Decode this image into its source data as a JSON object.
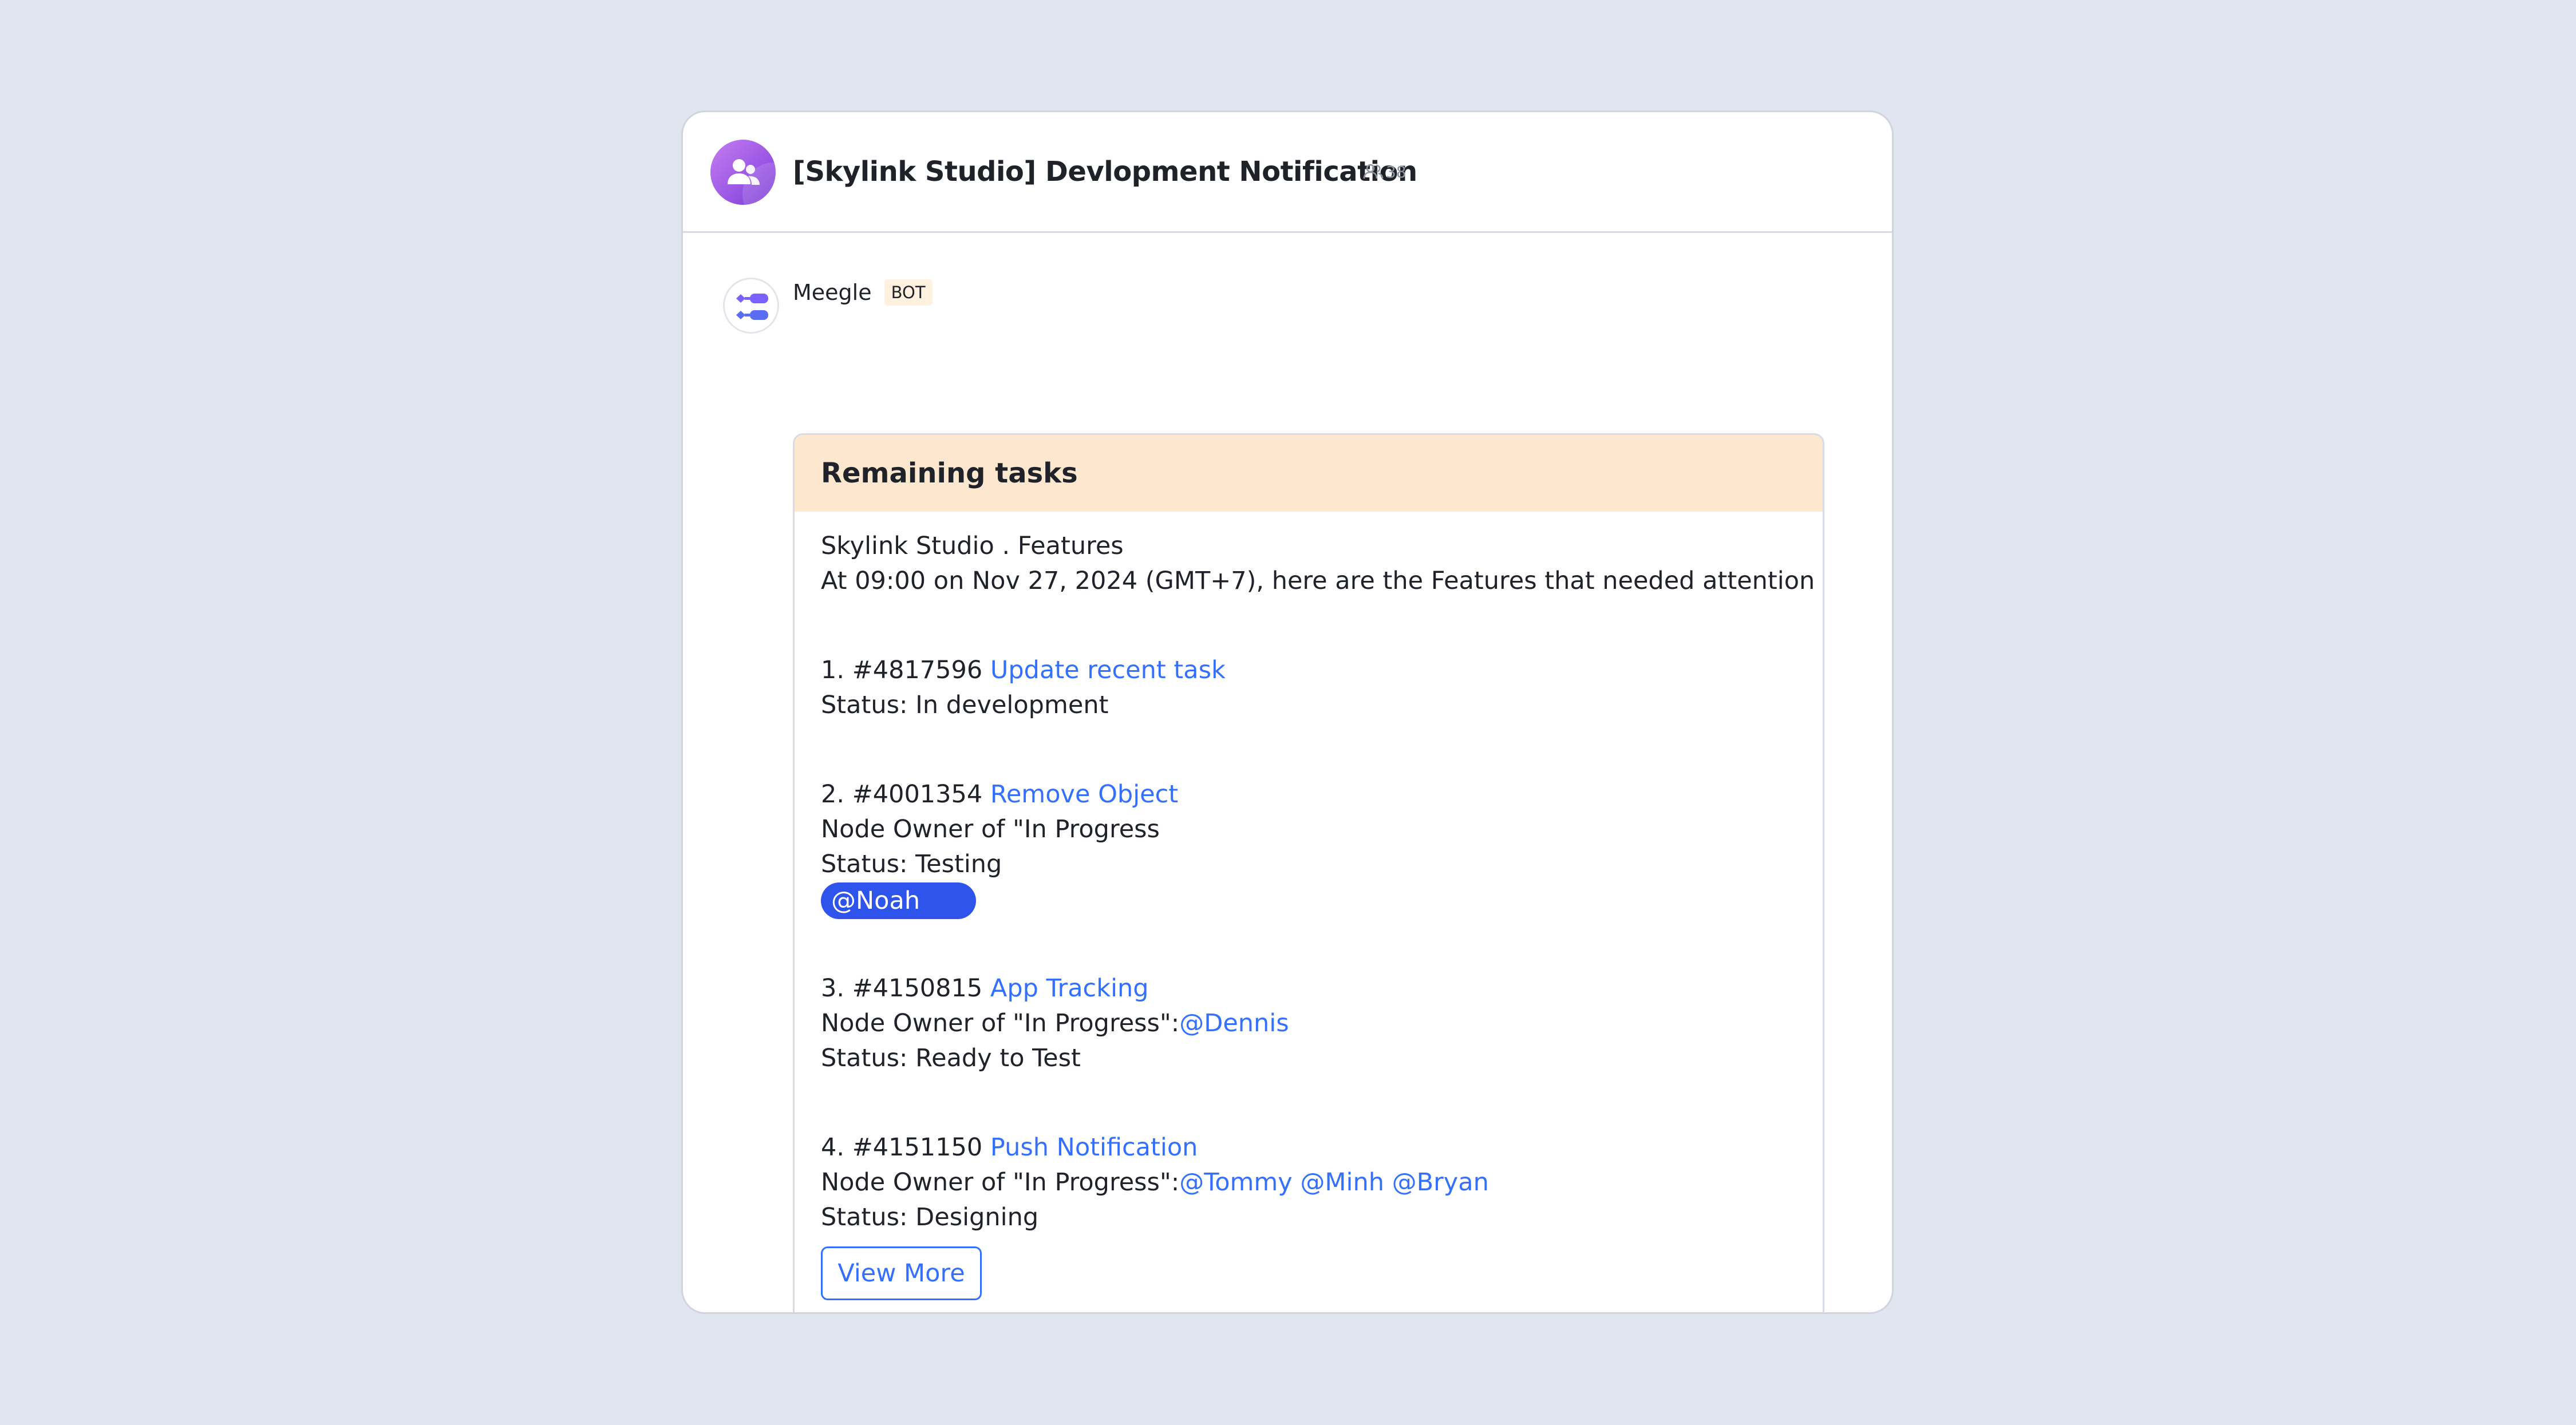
{
  "group": {
    "title": "[Skylink Studio] Devlopment Notification",
    "member_count": "38",
    "avatar_icon": "group-icon",
    "avatar_color": "#a35fe8"
  },
  "message": {
    "sender": "Meegle",
    "badge": "BOT",
    "avatar_icon": "meegle-logo-icon"
  },
  "card": {
    "title": "Remaining tasks",
    "header_color": "#fde7cf",
    "intro": [
      "Skylink Studio . Features",
      "At 09:00 on Nov 27, 2024 (GMT+7), here are the Features that needed attention"
    ],
    "tasks": [
      {
        "prefix": "1. #4817596 ",
        "name": "Update recent task",
        "status": "Status: In development"
      },
      {
        "prefix": "2. #4001354 ",
        "name": "Remove Object",
        "owner_label": "Node Owner of \"In Progress",
        "status": "Status: Testing",
        "mention": "@Noah"
      },
      {
        "prefix": "3. #4150815 ",
        "name": "App Tracking",
        "owner_label": "Node Owner of \"In Progress\":",
        "owners": "@Dennis",
        "status": "Status: Ready to Test"
      },
      {
        "prefix": "4. #4151150 ",
        "name": "Push Notification",
        "owner_label": "Node Owner of \"In Progress\":",
        "owners": "@Tommy @Minh @Bryan",
        "status": "Status: Designing"
      }
    ],
    "button": "View More",
    "link_color": "#3370ff",
    "mention_color": "#2f54eb"
  }
}
